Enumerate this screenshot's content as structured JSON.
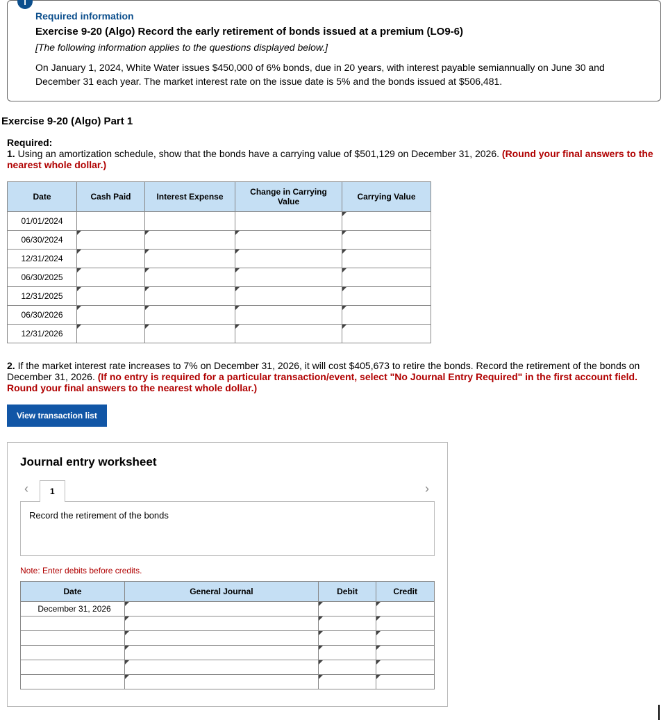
{
  "info": {
    "required_label": "Required information",
    "title": "Exercise 9-20 (Algo) Record the early retirement of bonds issued at a premium (LO9-6)",
    "applies": "[The following information applies to the questions displayed below.]",
    "paragraph": "On January 1, 2024, White Water issues $450,000 of 6% bonds, due in 20 years, with interest payable semiannually on June 30 and December 31 each year. The market interest rate on the issue date is 5% and the bonds issued at $506,481."
  },
  "part_header": "Exercise 9-20 (Algo) Part 1",
  "required": {
    "label": "Required:",
    "q1_prefix": "1.",
    "q1_text": " Using an amortization schedule, show that the bonds have a carrying value of $501,129 on December 31, 2026. ",
    "q1_red": "(Round your final answers to the nearest whole dollar.)"
  },
  "amort": {
    "headers": {
      "date": "Date",
      "cash": "Cash Paid",
      "intexp": "Interest Expense",
      "chg": "Change in Carrying Value",
      "cv": "Carrying Value"
    },
    "rows": [
      {
        "date": "01/01/2024"
      },
      {
        "date": "06/30/2024"
      },
      {
        "date": "12/31/2024"
      },
      {
        "date": "06/30/2025"
      },
      {
        "date": "12/31/2025"
      },
      {
        "date": "06/30/2026"
      },
      {
        "date": "12/31/2026"
      }
    ]
  },
  "q2": {
    "prefix": "2.",
    "text": " If the market interest rate increases to 7% on December 31, 2026, it will cost $405,673 to retire the bonds. Record the retirement of the bonds on December 31, 2026. ",
    "red": "(If no entry is required for a particular transaction/event, select \"No Journal Entry Required\" in the first account field. Round your final answers to the nearest whole dollar.)"
  },
  "buttons": {
    "view_txn": "View transaction list"
  },
  "journal": {
    "title": "Journal entry worksheet",
    "tab1": "1",
    "instruction": "Record the retirement of the bonds",
    "note": "Note: Enter debits before credits.",
    "headers": {
      "date": "Date",
      "gj": "General Journal",
      "debit": "Debit",
      "credit": "Credit"
    },
    "entry_date": "December 31, 2026"
  }
}
